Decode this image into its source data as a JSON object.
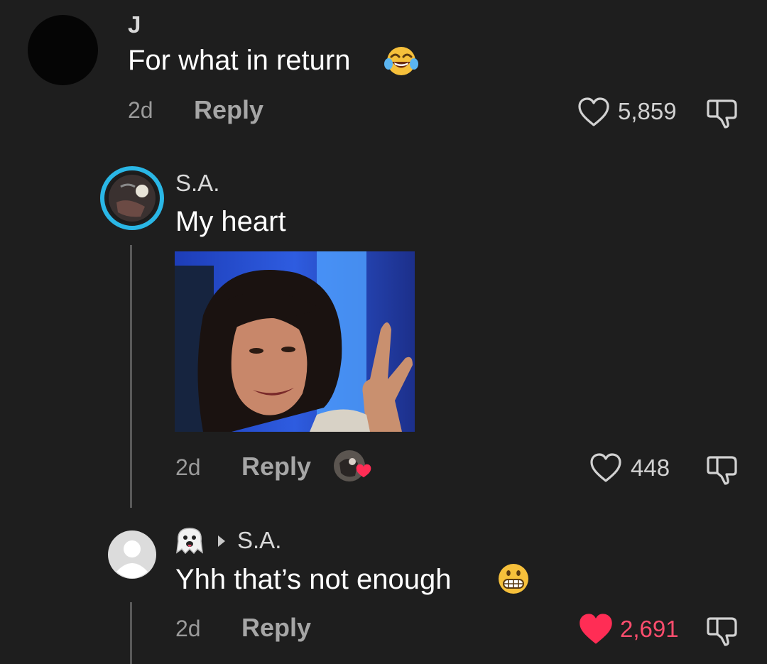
{
  "comments": [
    {
      "username": "J",
      "text": "For what in return",
      "time": "2d",
      "reply_label": "Reply",
      "likes": "5,859",
      "liked": false
    },
    {
      "username": "S.A.",
      "text": "My heart",
      "time": "2d",
      "reply_label": "Reply",
      "likes": "448",
      "liked": false
    },
    {
      "reply_to": "S.A.",
      "text": "Yhh that’s not enough",
      "time": "2d",
      "reply_label": "Reply",
      "likes": "2,691",
      "liked": true
    }
  ],
  "colors": {
    "background": "#1e1e1e",
    "like_active": "#ff4d6d",
    "story_ring": "#2ab7e6"
  },
  "icons": [
    "heart-outline-icon",
    "heart-filled-icon",
    "dislike-icon",
    "laughing-emoji",
    "grimacing-emoji",
    "ghost-emoji",
    "play-triangle-icon"
  ]
}
